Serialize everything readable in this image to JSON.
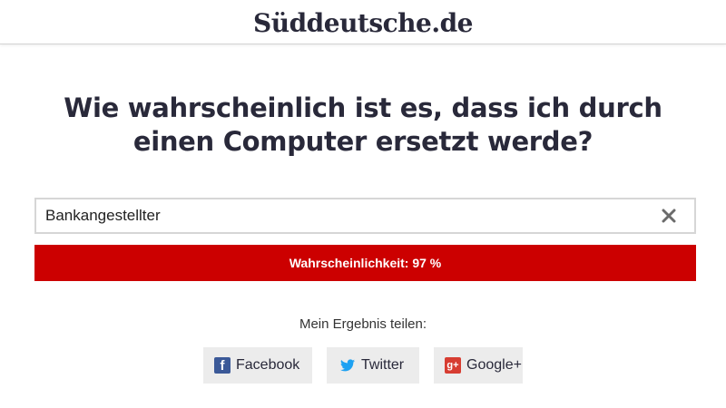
{
  "masthead": {
    "logo": "Süddeutsche.de"
  },
  "headline": {
    "line1": "Wie wahrscheinlich ist es, dass ich durch",
    "line2": "einen Computer ersetzt werde?"
  },
  "search": {
    "value": "Bankangestellter",
    "clear_icon": "close-icon"
  },
  "result": {
    "text": "Wahrscheinlichkeit: 97 %",
    "probability_percent": 97,
    "color": "#cc0000"
  },
  "share": {
    "label": "Mein Ergebnis teilen:",
    "buttons": [
      {
        "label": "Facebook",
        "icon": "facebook-icon",
        "color": "#3b5998"
      },
      {
        "label": "Twitter",
        "icon": "twitter-icon",
        "color": "#1da1f2"
      },
      {
        "label": "Google+",
        "icon": "google-plus-icon",
        "color": "#d73d32"
      }
    ]
  }
}
